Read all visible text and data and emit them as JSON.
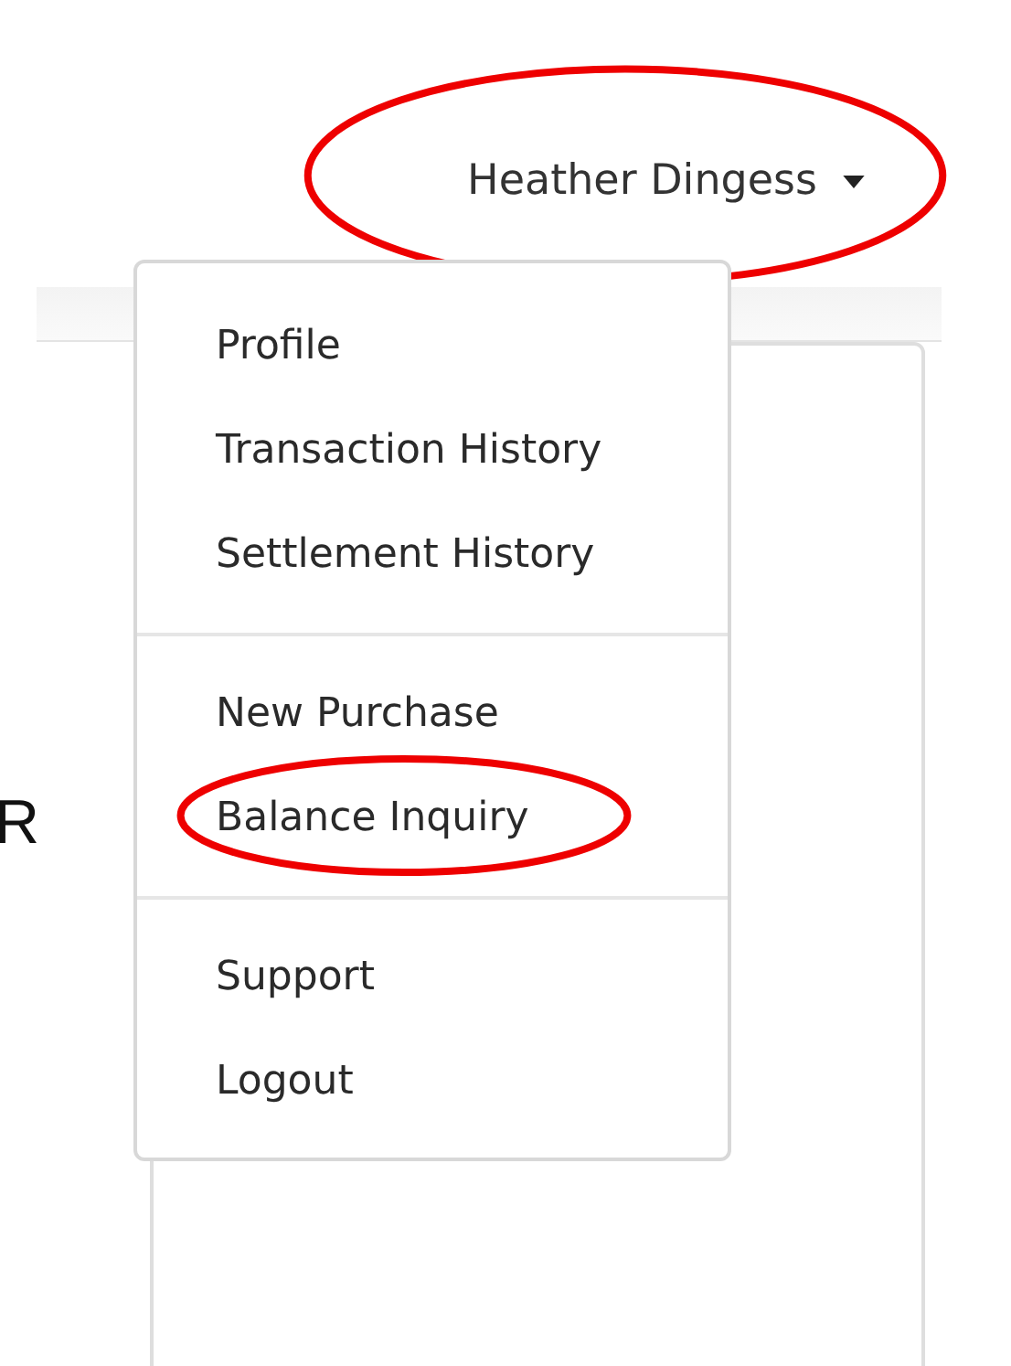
{
  "user_menu": {
    "label": "Heather Dingess",
    "expanded": true,
    "highlighted": true
  },
  "page_text": "R",
  "menu_groups": [
    {
      "items": [
        {
          "label": "Profile",
          "highlighted": false
        },
        {
          "label": "Transaction History",
          "highlighted": false
        },
        {
          "label": "Settlement History",
          "highlighted": false
        }
      ]
    },
    {
      "items": [
        {
          "label": "New Purchase",
          "highlighted": false
        },
        {
          "label": "Balance Inquiry",
          "highlighted": true
        }
      ]
    },
    {
      "items": [
        {
          "label": "Support",
          "highlighted": false
        },
        {
          "label": "Logout",
          "highlighted": false
        }
      ]
    }
  ]
}
